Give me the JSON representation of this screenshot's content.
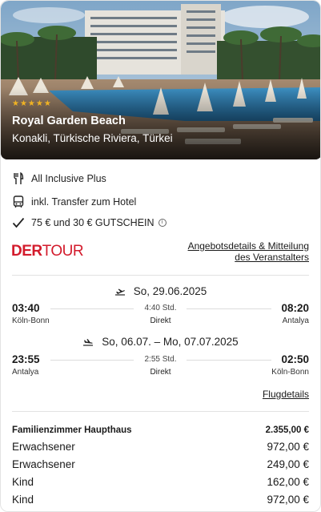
{
  "hotel": {
    "stars_label": "★★★★★",
    "rating_stars": 5,
    "name": "Royal Garden Beach",
    "location": "Konakli, Türkische Riviera, Türkei"
  },
  "features": [
    {
      "icon": "cutlery-icon",
      "label": "All Inclusive Plus"
    },
    {
      "icon": "bus-icon",
      "label": "inkl. Transfer zum Hotel"
    },
    {
      "icon": "checkmark-icon",
      "label": "75 € und 30 € GUTSCHEIN",
      "info_icon": "ⓘ"
    }
  ],
  "operator": {
    "logo_part1": "DER",
    "logo_part2": "TOUR",
    "brand_color": "#d31b2c",
    "details_link_line1": "Angebotsdetails & Mitteilung",
    "details_link_line2": "des Veranstalters"
  },
  "outbound": {
    "date": "So, 29.06.2025",
    "depart_time": "03:40",
    "depart_place": "Köln-Bonn",
    "duration": "4:40 Std.",
    "type": "Direkt",
    "arrive_time": "08:20",
    "arrive_place": "Antalya"
  },
  "return": {
    "date": "So, 06.07. – Mo, 07.07.2025",
    "depart_time": "23:55",
    "depart_place": "Antalya",
    "duration": "2:55 Std.",
    "type": "Direkt",
    "arrive_time": "02:50",
    "arrive_place": "Köln-Bonn"
  },
  "flight_details_link": "Flugdetails",
  "price_table": {
    "room_label": "Familienzimmer Haupthaus",
    "room_total": "2.355,00 €",
    "rows": [
      {
        "label": "Erwachsener",
        "price": "972,00 €"
      },
      {
        "label": "Erwachsener",
        "price": "249,00 €"
      },
      {
        "label": "Kind",
        "price": "162,00 €"
      },
      {
        "label": "Kind",
        "price": "972,00 €"
      }
    ]
  }
}
